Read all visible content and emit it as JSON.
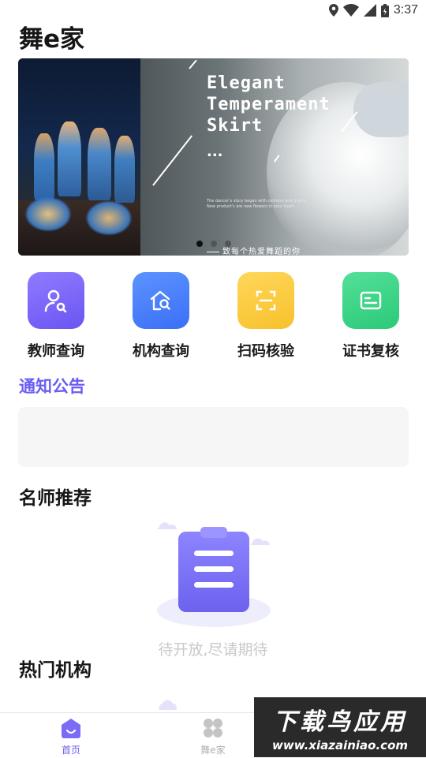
{
  "status_bar": {
    "time": "3:37",
    "icons": [
      "location-icon",
      "wifi-icon",
      "signal-icon",
      "battery-icon"
    ]
  },
  "app": {
    "title": "舞e家"
  },
  "banner": {
    "headline_lines": [
      "Elegant",
      "Temperament",
      "Skirt"
    ],
    "ellipsis": "...",
    "small_text": "The dancer's story began with collision and drama. New product's are new flowers in your heart.",
    "caption": "致每个热爱舞蹈的你",
    "page_count": 3,
    "active_index": 0
  },
  "quick_actions": [
    {
      "label": "教师查询",
      "icon": "teacher-search-icon",
      "color_top": "#8f7bff",
      "color_bottom": "#6a55f2"
    },
    {
      "label": "机构查询",
      "icon": "institution-search-icon",
      "color_top": "#5c93ff",
      "color_bottom": "#3b6ff7"
    },
    {
      "label": "扫码核验",
      "icon": "scan-code-icon",
      "color_top": "#ffd75a",
      "color_bottom": "#f7c12c"
    },
    {
      "label": "证书复核",
      "icon": "certificate-icon",
      "color_top": "#53e097",
      "color_bottom": "#2cc97a"
    }
  ],
  "notice": {
    "title": "通知公告"
  },
  "sections": {
    "teachers": "名师推荐",
    "institutions": "热门机构"
  },
  "empty_state": {
    "text": "待开放,尽请期待",
    "icon": "clipboard-icon"
  },
  "tabbar": {
    "tabs": [
      {
        "label": "首页",
        "icon": "home-icon",
        "active": true
      },
      {
        "label": "舞e家",
        "icon": "grid-icon",
        "active": false
      }
    ],
    "active_color": "#6a5cf5",
    "inactive_color": "#b0b0b0"
  },
  "watermark": {
    "title": "下载鸟应用",
    "url": "www.xiazainiao.com"
  }
}
